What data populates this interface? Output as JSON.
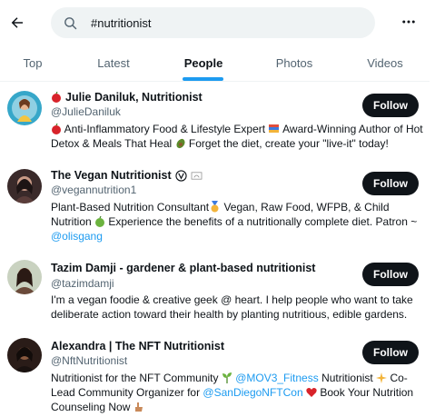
{
  "search": {
    "value": "#nutritionist",
    "icon": "search-icon"
  },
  "tabs": [
    {
      "label": "Top"
    },
    {
      "label": "Latest"
    },
    {
      "label": "People",
      "active": true
    },
    {
      "label": "Photos"
    },
    {
      "label": "Videos"
    }
  ],
  "accent": "#1d9bf0",
  "users": [
    {
      "name": "Julie Daniluk, Nutritionist",
      "handle": "@JulieDaniluk",
      "follow": "Follow",
      "bio": {
        "t1": "Anti-Inflammatory Food & Lifestyle Expert",
        "t2": "Award-Winning Author of Hot Detox & Meals That Heal",
        "t3": "Forget the diet, create your \"live-it\" today!"
      }
    },
    {
      "name": "The Vegan Nutritionist",
      "handle": "@vegannutrition1",
      "follow": "Follow",
      "bio": {
        "t1": "Plant-Based Nutrition Consultant",
        "t2": "Vegan, Raw Food, WFPB, & Child Nutrition",
        "t3": "Experience the benefits of a nutritionally complete diet. Patron ~",
        "link1": "@olisgang"
      }
    },
    {
      "name": "Tazim Damji - gardener & plant-based nutritionist",
      "handle": "@tazimdamji",
      "follow": "Follow",
      "bio": {
        "t1": "I'm a vegan foodie & creative geek @ heart. I help people who want to take deliberate action toward their health by planting nutritious, edible gardens."
      }
    },
    {
      "name": "Alexandra | The NFT Nutritionist",
      "handle": "@NftNutritionist",
      "follow": "Follow",
      "bio": {
        "t1": "Nutritionist for the NFT Community",
        "link1": "@MOV3_Fitness",
        "t2": "Nutritionist",
        "t3": "Co-Lead Community Organizer for",
        "link2": "@SanDiegoNFTCon",
        "t4": "Book Your Nutrition Counseling Now"
      }
    }
  ]
}
